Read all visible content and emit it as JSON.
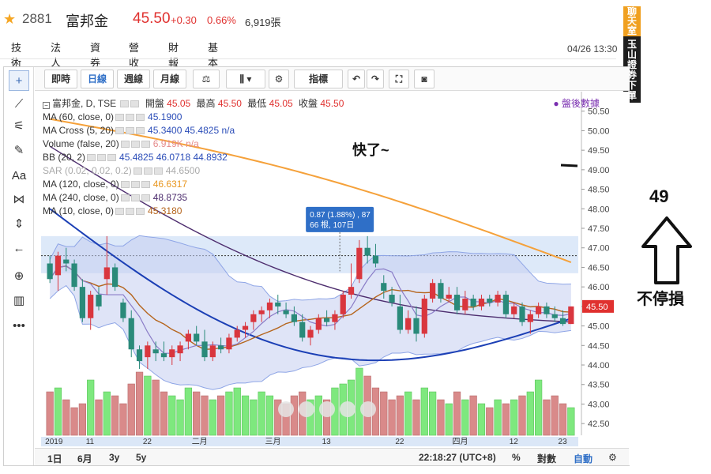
{
  "header": {
    "stock_code": "2881",
    "stock_name": "富邦金",
    "price": "45.50",
    "change": "+0.30",
    "change_pct": "0.66%",
    "volume": "6,919張",
    "timestamp": "04/26 13:30"
  },
  "nav_tabs": [
    "技術",
    "法人",
    "資券",
    "營收",
    "財報",
    "基本"
  ],
  "side_banner": {
    "top": "聊天室",
    "bottom": "玉山證券下單"
  },
  "toolbar": {
    "intraday": "即時",
    "daily": "日線",
    "weekly": "週線",
    "monthly": "月線",
    "indicators": "指標"
  },
  "legend": {
    "main": {
      "label": "富邦金, D, TSE",
      "open_label": "開盤",
      "open": "45.05",
      "high_label": "最高",
      "high": "45.50",
      "low_label": "最低",
      "low": "45.05",
      "close_label": "收盤",
      "close": "45.50"
    },
    "rows": [
      {
        "label": "MA (60, close, 0)",
        "value": "45.1900"
      },
      {
        "label": "MA Cross (5, 20)",
        "value": "45.3400  45.4825  n/a"
      },
      {
        "label": "Volume (false, 20)",
        "value": "6.919K  n/a"
      },
      {
        "label": "BB (20, 2)",
        "value": "45.4825  46.0718  44.8932"
      },
      {
        "label": "SAR (0.02, 0.02, 0.2)",
        "value": "44.6500"
      },
      {
        "label": "MA (120, close, 0)",
        "value": "46.6317"
      },
      {
        "label": "MA (240, close, 0)",
        "value": "48.8735"
      },
      {
        "label": "MA (10, close, 0)",
        "value": "45.3180"
      }
    ],
    "after_market": "● 盤後數據"
  },
  "tooltip": {
    "line1": "0.87 (1.88%) , 87",
    "line2": "66 根, 107日"
  },
  "bottombar": {
    "ranges": [
      "1日",
      "6月",
      "3y",
      "5y"
    ],
    "clock": "22:18:27 (UTC+8)",
    "percent": "%",
    "log": "對數",
    "auto": "自動"
  },
  "annotations": {
    "fast": "快了~",
    "target": "49",
    "no_stop": "不停損"
  },
  "chart_data": {
    "type": "candlestick",
    "title": "富邦金, D, TSE",
    "ylim": [
      42.2,
      51.0
    ],
    "y_ticks": [
      "50.50",
      "50.00",
      "49.50",
      "49.00",
      "48.50",
      "48.00",
      "47.50",
      "47.00",
      "46.50",
      "46.00",
      "45.50",
      "45.00",
      "44.50",
      "44.00",
      "43.50",
      "43.00",
      "42.50"
    ],
    "x_labels": [
      {
        "i": 0,
        "t": "2019"
      },
      {
        "i": 5,
        "t": "11"
      },
      {
        "i": 12,
        "t": "22"
      },
      {
        "i": 18,
        "t": "二月"
      },
      {
        "i": 27,
        "t": "三月"
      },
      {
        "i": 34,
        "t": "13"
      },
      {
        "i": 43,
        "t": "22"
      },
      {
        "i": 50,
        "t": "四月"
      },
      {
        "i": 57,
        "t": "12"
      },
      {
        "i": 63,
        "t": "23"
      }
    ],
    "current_price": "45.50",
    "ohlc": [
      [
        46.6,
        46.8,
        46.1,
        46.2
      ],
      [
        46.3,
        46.9,
        45.9,
        46.8
      ],
      [
        46.7,
        47.0,
        46.4,
        46.6
      ],
      [
        46.6,
        46.7,
        45.9,
        46.0
      ],
      [
        46.0,
        46.2,
        45.1,
        45.2
      ],
      [
        45.2,
        45.9,
        44.9,
        45.8
      ],
      [
        45.8,
        46.0,
        45.4,
        45.5
      ],
      [
        46.2,
        47.3,
        45.8,
        46.5
      ],
      [
        46.5,
        46.6,
        45.9,
        46.0
      ],
      [
        45.6,
        45.7,
        45.1,
        45.2
      ],
      [
        45.2,
        45.4,
        44.2,
        44.4
      ],
      [
        44.4,
        44.5,
        43.9,
        44.1
      ],
      [
        44.2,
        44.6,
        43.9,
        44.5
      ],
      [
        44.4,
        44.6,
        44.1,
        44.3
      ],
      [
        44.3,
        44.6,
        44.1,
        44.2
      ],
      [
        44.2,
        44.5,
        44.0,
        44.4
      ],
      [
        44.3,
        44.6,
        44.1,
        44.5
      ],
      [
        44.6,
        44.9,
        44.4,
        44.8
      ],
      [
        44.8,
        45.0,
        44.5,
        44.6
      ],
      [
        44.6,
        44.9,
        44.1,
        44.2
      ],
      [
        44.2,
        44.6,
        44.1,
        44.5
      ],
      [
        44.5,
        44.7,
        44.3,
        44.4
      ],
      [
        44.4,
        44.8,
        44.3,
        44.7
      ],
      [
        44.7,
        45.0,
        44.6,
        44.9
      ],
      [
        44.9,
        45.1,
        44.7,
        45.0
      ],
      [
        45.1,
        45.4,
        44.9,
        45.3
      ],
      [
        45.3,
        45.5,
        45.1,
        45.4
      ],
      [
        45.4,
        45.7,
        45.2,
        45.6
      ],
      [
        45.6,
        45.8,
        45.3,
        45.5
      ],
      [
        45.4,
        45.6,
        45.2,
        45.3
      ],
      [
        45.3,
        45.5,
        45.0,
        45.1
      ],
      [
        45.1,
        45.3,
        44.6,
        44.7
      ],
      [
        44.7,
        45.0,
        44.5,
        44.9
      ],
      [
        44.9,
        45.3,
        44.8,
        45.2
      ],
      [
        45.2,
        45.4,
        45.0,
        45.1
      ],
      [
        45.1,
        45.4,
        44.9,
        45.3
      ],
      [
        45.3,
        45.9,
        45.2,
        45.8
      ],
      [
        45.8,
        46.6,
        45.7,
        46.0
      ],
      [
        46.2,
        47.2,
        46.1,
        47.0
      ],
      [
        47.0,
        47.3,
        46.6,
        46.8
      ],
      [
        46.8,
        47.1,
        46.5,
        46.6
      ],
      [
        46.1,
        46.3,
        45.7,
        45.9
      ],
      [
        45.8,
        46.0,
        45.5,
        45.6
      ],
      [
        45.5,
        45.8,
        44.8,
        44.9
      ],
      [
        44.9,
        45.4,
        44.8,
        45.2
      ],
      [
        45.2,
        45.5,
        44.6,
        44.8
      ],
      [
        44.8,
        45.8,
        44.7,
        45.7
      ],
      [
        45.7,
        46.2,
        45.6,
        46.1
      ],
      [
        46.1,
        46.2,
        45.6,
        45.7
      ],
      [
        45.7,
        46.0,
        45.6,
        45.8
      ],
      [
        45.8,
        46.0,
        45.3,
        45.4
      ],
      [
        45.4,
        45.9,
        45.3,
        45.7
      ],
      [
        45.7,
        45.8,
        45.4,
        45.5
      ],
      [
        45.5,
        45.8,
        45.4,
        45.7
      ],
      [
        45.7,
        45.8,
        45.5,
        45.6
      ],
      [
        45.6,
        45.9,
        45.5,
        45.8
      ],
      [
        45.8,
        45.9,
        45.2,
        45.3
      ],
      [
        45.3,
        45.6,
        45.2,
        45.5
      ],
      [
        45.5,
        45.6,
        45.0,
        45.1
      ],
      [
        45.1,
        45.4,
        44.8,
        45.3
      ],
      [
        45.3,
        45.6,
        45.2,
        45.5
      ],
      [
        45.5,
        45.6,
        45.2,
        45.3
      ],
      [
        45.3,
        45.5,
        45.1,
        45.2
      ],
      [
        45.2,
        45.4,
        45.0,
        45.05
      ],
      [
        45.05,
        45.5,
        45.05,
        45.5
      ]
    ],
    "volume_relative": [
      0.55,
      0.6,
      0.45,
      0.35,
      0.4,
      0.7,
      0.45,
      0.55,
      0.5,
      0.4,
      0.65,
      0.8,
      0.75,
      0.7,
      0.55,
      0.5,
      0.45,
      0.6,
      0.55,
      0.5,
      0.45,
      0.5,
      0.55,
      0.6,
      0.5,
      0.45,
      0.55,
      0.5,
      0.45,
      0.4,
      0.5,
      0.55,
      0.45,
      0.5,
      0.45,
      0.6,
      0.65,
      0.7,
      0.85,
      0.75,
      0.6,
      0.55,
      0.45,
      0.5,
      0.55,
      0.45,
      0.6,
      0.55,
      0.45,
      0.4,
      0.55,
      0.45,
      0.5,
      0.4,
      0.35,
      0.45,
      0.4,
      0.45,
      0.5,
      0.55,
      0.7,
      0.45,
      0.5,
      0.4,
      0.35
    ],
    "lines": {
      "ma120": {
        "color": "#f5a13a",
        "start": 50.3,
        "end": 46.63
      },
      "ma240": {
        "color": "#4d2d6e",
        "start": 49.6,
        "end": 45.1
      },
      "ma60": {
        "color": "#1b3fb5",
        "start": 48.0,
        "end": 45.19
      }
    },
    "bb_upper_band": "#8ea5e6",
    "highlight_band": [
      46.35,
      47.3
    ],
    "dotted_level": 46.8
  }
}
